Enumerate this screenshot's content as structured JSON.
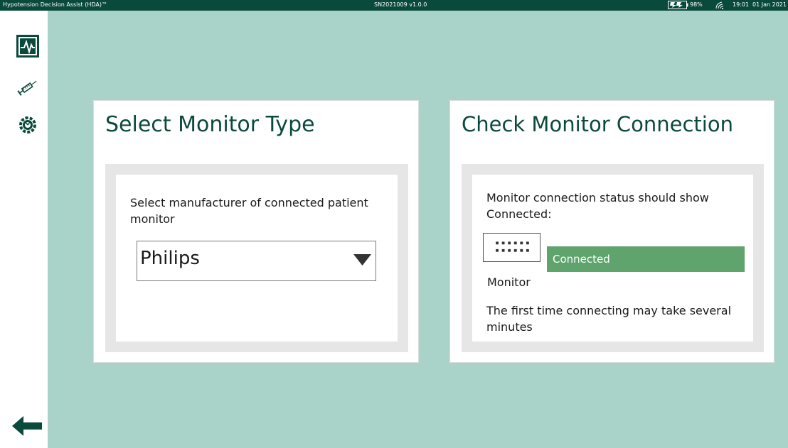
{
  "topbar": {
    "app_title": "Hypotension Decision Assist (HDA)™",
    "serial": "SN2021009 v1.0.0",
    "battery_pct": "98%",
    "time": "19:01",
    "date": "01 Jan 2021",
    "battery_icon": "battery-charging-icon",
    "wifi_icon": "wifi-icon"
  },
  "sidebar": {
    "items": [
      {
        "icon": "monitor-waveform-icon"
      },
      {
        "icon": "syringe-icon"
      },
      {
        "icon": "settings-icon"
      }
    ],
    "back_icon": "back-arrow-icon"
  },
  "left_panel": {
    "title": "Select Monitor Type",
    "instruction": "Select manufacturer of connected patient monitor",
    "dropdown_value": "Philips"
  },
  "right_panel": {
    "title": "Check Monitor Connection",
    "instruction": "Monitor connection status should show Connected:",
    "status_text": "Connected",
    "monitor_caption": "Monitor",
    "note": "The first time connecting may take several minutes"
  },
  "colors": {
    "background": "#a9d3c9",
    "brand_dark": "#0a4a3c",
    "connected_green": "#5ea46c"
  }
}
